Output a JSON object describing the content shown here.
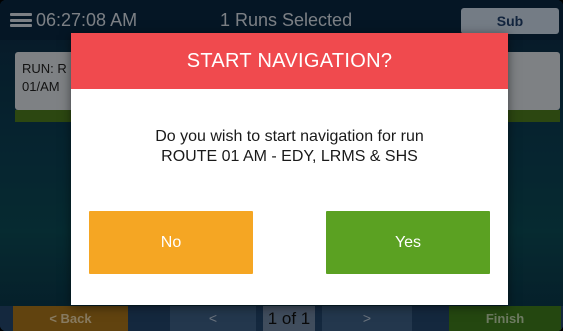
{
  "topbar": {
    "clock": "06:27:08 AM",
    "runs_selected": "1 Runs Selected",
    "sub_label": "Sub",
    "menu_icon": "hamburger-menu-icon"
  },
  "run_card": {
    "line1": "RUN: R",
    "line2": "01/AM"
  },
  "bottombar": {
    "back_label": "< Back",
    "prev_label": "<",
    "page": "1 of 1",
    "next_label": ">",
    "finish_label": "Finish"
  },
  "dialog": {
    "title": "START NAVIGATION?",
    "message_line1": "Do you wish to start navigation for run",
    "message_line2": "ROUTE 01 AM - EDY, LRMS & SHS",
    "no_label": "No",
    "yes_label": "Yes"
  },
  "colors": {
    "header_red": "#f04a4e",
    "no_orange": "#f5a623",
    "yes_green": "#5ba122"
  }
}
